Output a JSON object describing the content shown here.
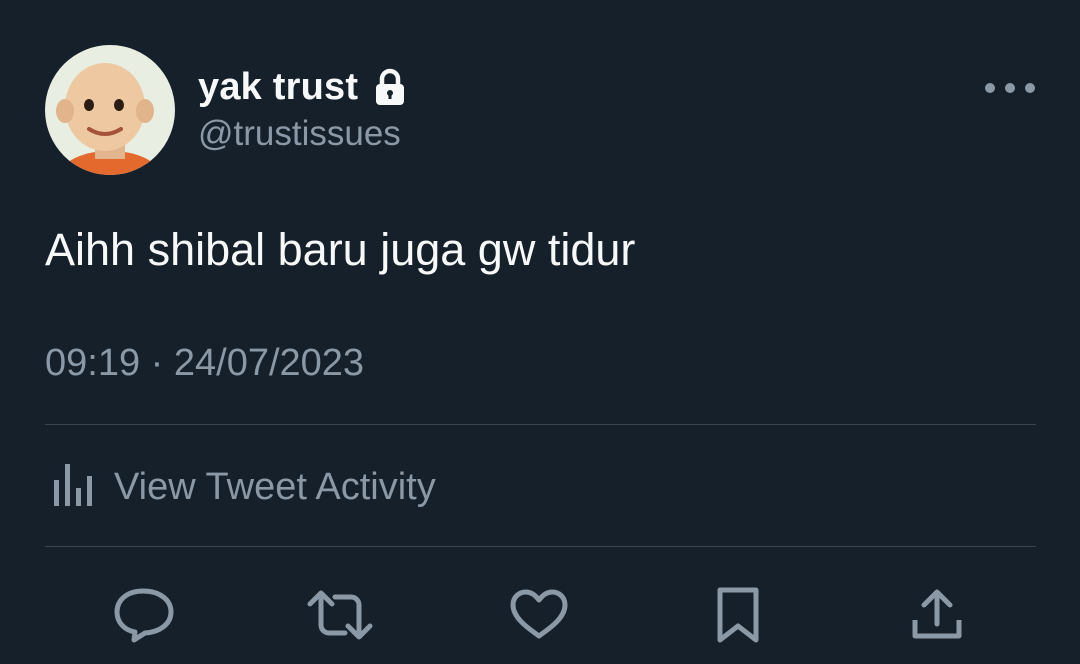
{
  "tweet": {
    "display_name": "yak trust",
    "handle": "@trustissues",
    "protected_icon": "lock-icon",
    "text": "Aihh shibal baru juga gw tidur",
    "timestamp": "09:19 · 24/07/2023"
  },
  "menu": {
    "more_icon": "more-horizontal-icon"
  },
  "activity": {
    "icon": "bar-chart-icon",
    "label": "View Tweet Activity"
  },
  "actions": [
    {
      "name": "reply",
      "icon": "reply-icon"
    },
    {
      "name": "retweet",
      "icon": "retweet-icon"
    },
    {
      "name": "like",
      "icon": "heart-icon"
    },
    {
      "name": "bookmark",
      "icon": "bookmark-icon"
    },
    {
      "name": "share",
      "icon": "share-icon"
    }
  ],
  "colors": {
    "background": "#15202b",
    "primary_text": "#f7f9f9",
    "secondary_text": "#8b98a5",
    "divider": "#38444d"
  }
}
